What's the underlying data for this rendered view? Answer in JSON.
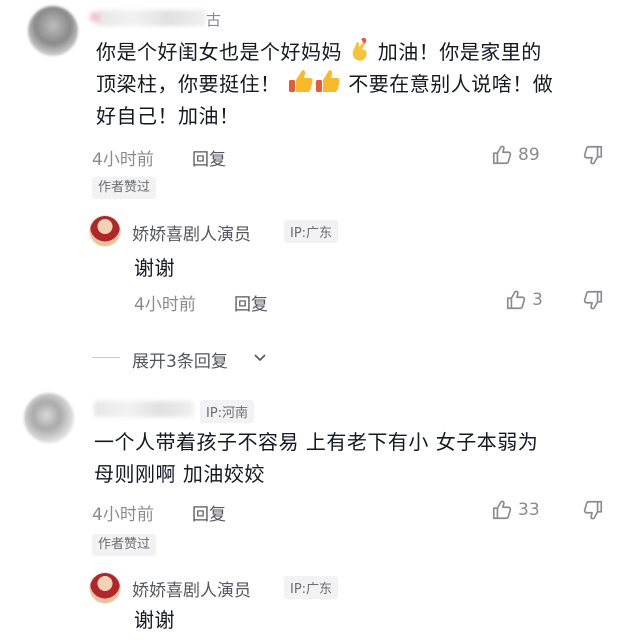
{
  "comments": [
    {
      "name_suffix": "古",
      "text_part1": "你是个好闺女也是个好妈妈",
      "text_part2": "加油！你是家里的",
      "line2_a": "顶梁柱，你要挺住！",
      "line2_b": "不要在意别人说啥！做",
      "line3": "好自己！加油！",
      "time": "4小时前",
      "reply": "回复",
      "likes": "89",
      "author_liked": "作者赞过",
      "replies": [
        {
          "name": "娇娇喜剧人演员",
          "ip": "IP:广东",
          "text": "谢谢",
          "time": "4小时前",
          "reply": "回复",
          "likes": "3"
        }
      ],
      "expand": "展开3条回复"
    },
    {
      "ip": "IP:河南",
      "line1": "一个人带着孩子不容易 上有老下有小 女子本弱为",
      "line2": "母则刚啊 加油姣姣",
      "time": "4小时前",
      "reply": "回复",
      "likes": "33",
      "author_liked": "作者赞过",
      "replies": [
        {
          "name": "娇娇喜剧人演员",
          "ip": "IP:广东",
          "text": "谢谢"
        }
      ]
    }
  ],
  "icons": {
    "heart_hand": "finger-heart-emoji",
    "thumbs": "thumbs-up-emoji",
    "like": "thumb-up-outline-icon",
    "dislike": "thumb-down-outline-icon",
    "chevron": "chevron-down-icon"
  },
  "colors": {
    "text": "#161823",
    "meta": "#8a8b91",
    "badge_bg": "#f2f2f4"
  }
}
